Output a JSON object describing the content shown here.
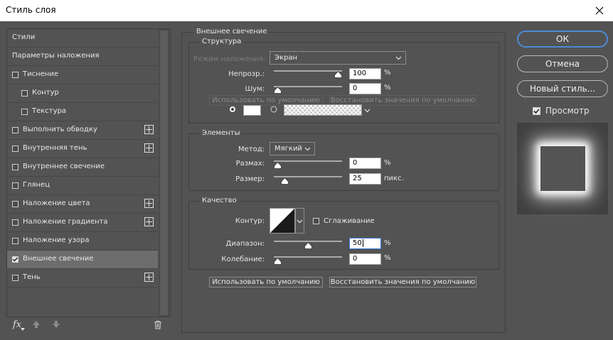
{
  "window": {
    "title": "Стиль слоя"
  },
  "left_panel": {
    "items": [
      {
        "label": "Стили",
        "checkbox": false,
        "checked": false,
        "plus": false,
        "indent": 0,
        "selected": false
      },
      {
        "label": "Параметры наложения",
        "checkbox": false,
        "checked": false,
        "plus": false,
        "indent": 0,
        "selected": false
      },
      {
        "label": "Тиснение",
        "checkbox": true,
        "checked": false,
        "plus": false,
        "indent": 0,
        "selected": false
      },
      {
        "label": "Контур",
        "checkbox": true,
        "checked": false,
        "plus": false,
        "indent": 1,
        "selected": false
      },
      {
        "label": "Текстура",
        "checkbox": true,
        "checked": false,
        "plus": false,
        "indent": 1,
        "selected": false
      },
      {
        "label": "Выполнить обводку",
        "checkbox": true,
        "checked": false,
        "plus": true,
        "indent": 0,
        "selected": false
      },
      {
        "label": "Внутренняя тень",
        "checkbox": true,
        "checked": false,
        "plus": true,
        "indent": 0,
        "selected": false
      },
      {
        "label": "Внутреннее свечение",
        "checkbox": true,
        "checked": false,
        "plus": false,
        "indent": 0,
        "selected": false
      },
      {
        "label": "Глянец",
        "checkbox": true,
        "checked": false,
        "plus": false,
        "indent": 0,
        "selected": false
      },
      {
        "label": "Наложение цвета",
        "checkbox": true,
        "checked": false,
        "plus": true,
        "indent": 0,
        "selected": false
      },
      {
        "label": "Наложение градиента",
        "checkbox": true,
        "checked": false,
        "plus": true,
        "indent": 0,
        "selected": false
      },
      {
        "label": "Наложение узора",
        "checkbox": true,
        "checked": false,
        "plus": false,
        "indent": 0,
        "selected": false
      },
      {
        "label": "Внешнее свечение",
        "checkbox": true,
        "checked": true,
        "plus": false,
        "indent": 0,
        "selected": true
      },
      {
        "label": "Тень",
        "checkbox": true,
        "checked": false,
        "plus": true,
        "indent": 0,
        "selected": false
      }
    ],
    "footer_icons": [
      "fx-icon",
      "arrow-up-icon",
      "arrow-down-icon",
      "trash-icon"
    ],
    "fx_label": "fx"
  },
  "main": {
    "section_title": "Внешнее свечение",
    "structure": {
      "title": "Структура",
      "blend_mode_label": "Режим наложения:",
      "blend_mode_value": "Экран",
      "opacity_label": "Непрозр.:",
      "opacity_value": "100",
      "opacity_unit": "%",
      "opacity_level": 100,
      "noise_label": "Шум:",
      "noise_value": "0",
      "noise_unit": "%",
      "noise_level": 0,
      "use_default_label": "Использовать по умолчанию",
      "reset_default_label": "Восстановить значения по умолчанию"
    },
    "elements": {
      "title": "Элементы",
      "method_label": "Метод:",
      "method_value": "Мягкий",
      "spread_label": "Размах:",
      "spread_value": "0",
      "spread_unit": "%",
      "spread_level": 0,
      "size_label": "Размер:",
      "size_value": "25",
      "size_unit": "пикс.",
      "size_level": 12
    },
    "quality": {
      "title": "Качество",
      "contour_label": "Контур:",
      "antialias_label": "Сглаживание",
      "antialias_checked": false,
      "range_label": "Диапазон:",
      "range_value": "50",
      "range_unit": "%",
      "range_level": 50,
      "jitter_label": "Колебание:",
      "jitter_value": "0",
      "jitter_unit": "%",
      "jitter_level": 0
    },
    "bottom_buttons": {
      "use_default_label": "Использовать по умолчанию",
      "reset_default_label": "Восстановить значения по умолчанию"
    }
  },
  "right_panel": {
    "ok_label": "ОК",
    "cancel_label": "Отмена",
    "new_style_label": "Новый стиль...",
    "preview_label": "Просмотр",
    "preview_checked": true
  },
  "colors": {
    "accent": "#4d8ad8",
    "panel_bg": "#535353",
    "selected_bg": "#6d6d6d",
    "glow": "#ffffff"
  }
}
